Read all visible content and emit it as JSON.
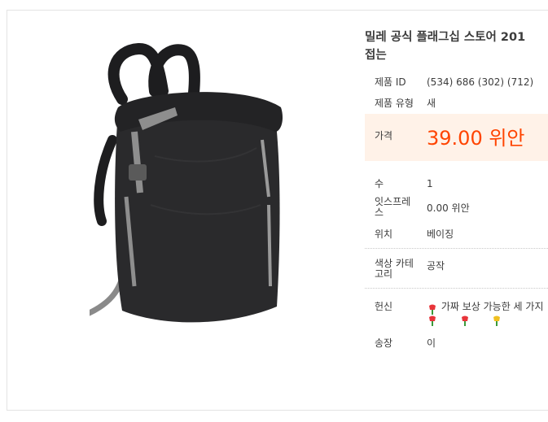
{
  "product": {
    "title_line1": "밀레 공식 플래그십 스토어 201",
    "title_line2": "접는",
    "id_label": "제품 ID",
    "id_value": "(534) 686 (302) (712)",
    "type_label": "제품 유형",
    "type_value": "새",
    "price_label": "가격",
    "price_value": "39.00 위안",
    "qty_label": "수",
    "qty_value": "1",
    "express_label_1": "잇스프레",
    "express_label_2": "스",
    "express_value": "0.00 위안",
    "location_label": "위치",
    "location_value": "베이징",
    "color_label_1": "색상 카테",
    "color_label_2": "고리",
    "color_value": "공작",
    "donation_label": "헌신",
    "donation_value": "가짜 보상 가능한 세 가지",
    "invoice_label": "송장",
    "invoice_value": "이"
  },
  "colors": {
    "price": "#ff4400",
    "price_bg": "#fff2e8"
  }
}
